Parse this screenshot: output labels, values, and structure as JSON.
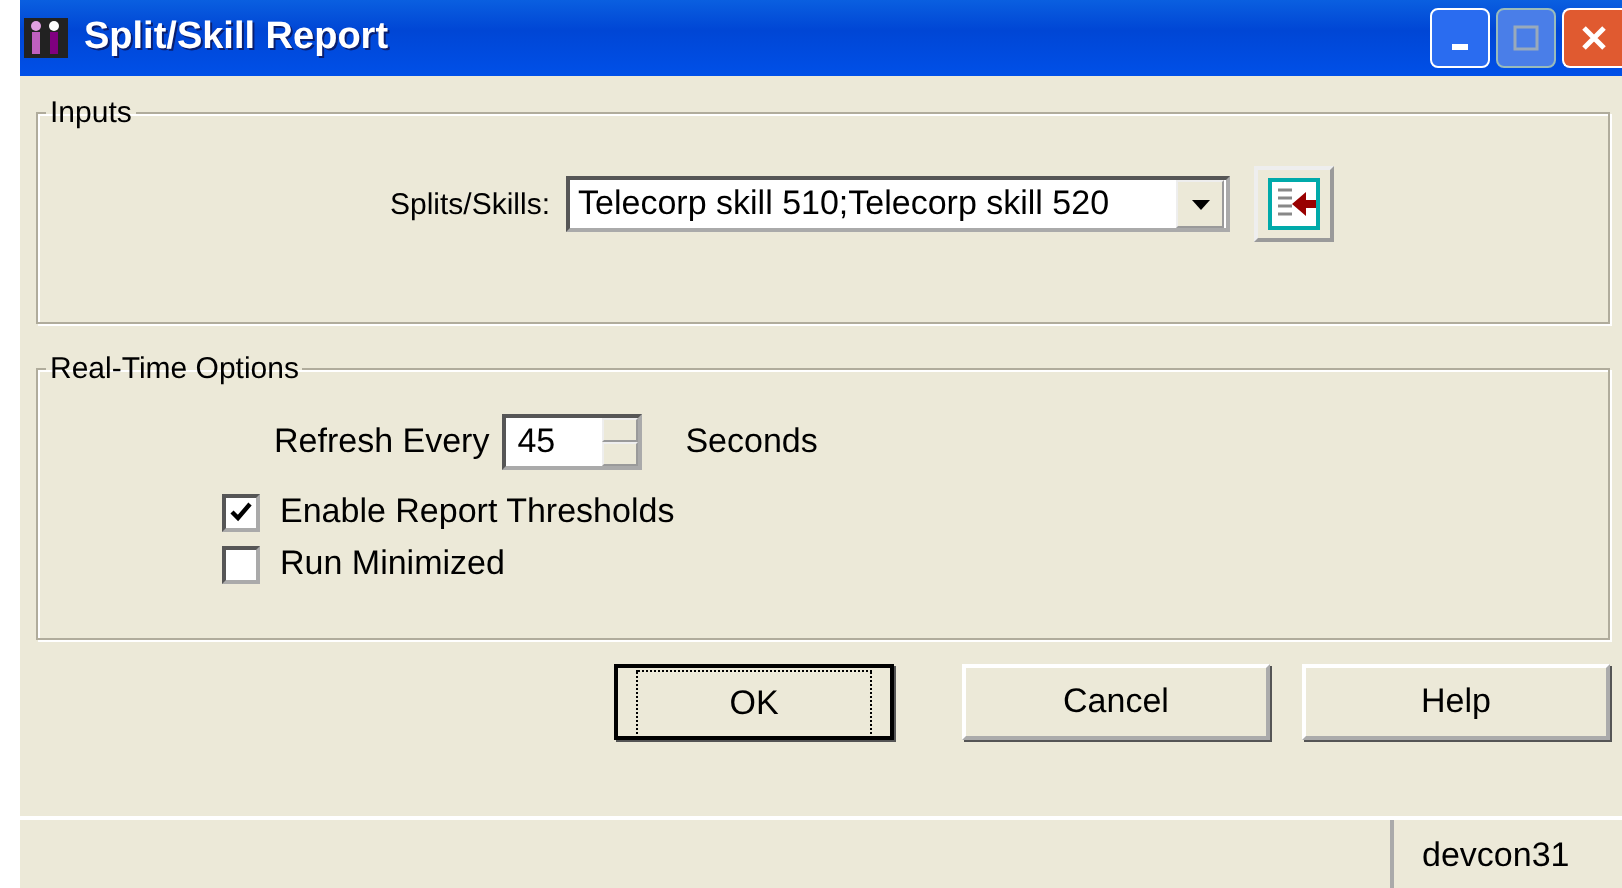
{
  "window": {
    "title": "Split/Skill Report"
  },
  "inputs": {
    "title": "Inputs",
    "label": "Splits/Skills:",
    "value": "Telecorp skill 510;Telecorp skill 520"
  },
  "real_time_options": {
    "title": "Real-Time Options",
    "refresh_label": "Refresh Every",
    "refresh_value": "45",
    "refresh_unit": "Seconds",
    "checkboxes": [
      {
        "label": "Enable Report Thresholds",
        "checked": true
      },
      {
        "label": "Run Minimized",
        "checked": false
      }
    ]
  },
  "buttons": [
    {
      "label": "OK",
      "default": true
    },
    {
      "label": "Cancel",
      "default": false
    },
    {
      "label": "Help",
      "default": false
    }
  ],
  "status_bar": {
    "panel": "devcon31"
  }
}
